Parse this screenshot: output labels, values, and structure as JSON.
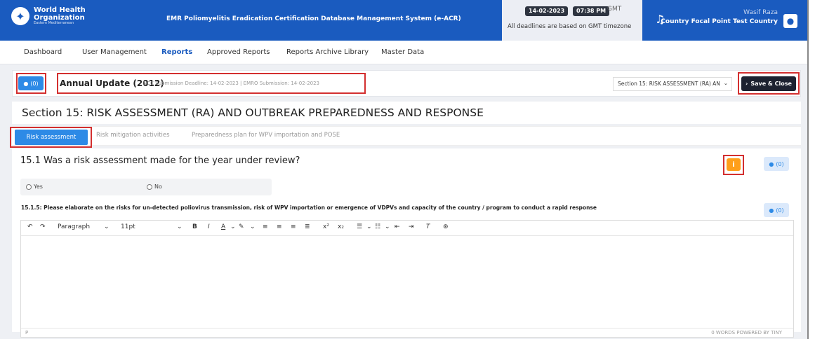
{
  "header": {
    "logo_line1": "World Health",
    "logo_line2": "Organization",
    "logo_line3": "Eastern Mediterranean",
    "app_title": "EMR Poliomyelitis Eradication Certification Database Management System (e-ACR)",
    "date": "14-02-2023",
    "time": "07:38 PM",
    "timezone": "GMT",
    "deadline_note": "All deadlines are based on GMT timezone",
    "user_name": "Wasif Raza",
    "user_role": "Country Focal Point Test Country"
  },
  "nav": {
    "items": [
      {
        "label": "Dashboard"
      },
      {
        "label": "User Management"
      },
      {
        "label": "Reports"
      },
      {
        "label": "Approved Reports"
      },
      {
        "label": "Reports Archive Library"
      },
      {
        "label": "Master Data"
      }
    ]
  },
  "report": {
    "comments_count": "(0)",
    "title": "Annual Update (2012)",
    "deadlines": "NCC Submission Deadline: 14-02-2023 | EMRO Submission: 14-02-2023",
    "section_select": "Section 15: RISK ASSESSMENT (RA) AN",
    "save_label": "Save & Close"
  },
  "section": {
    "title": "Section 15: RISK ASSESSMENT (RA) AND OUTBREAK PREPAREDNESS AND RESPONSE",
    "tabs": [
      {
        "label": "Risk assessment"
      },
      {
        "label": "Risk mitigation activities"
      },
      {
        "label": "Preparedness plan for WPV importation and POSE"
      }
    ]
  },
  "question": {
    "title": "15.1 Was a risk assessment made for the year under review?",
    "info_icon": "i",
    "comments_count": "(0)",
    "options": [
      {
        "label": "Yes"
      },
      {
        "label": "No"
      }
    ],
    "sub_question": "15.1.5: Please elaborate on the risks for un-detected poliovirus transmission, risk of WPV importation or emergence of VDPVs and capacity of the country / program to conduct a rapid response",
    "sub_comments_count": "(0)"
  },
  "editor": {
    "block_format": "Paragraph",
    "font_size": "11pt",
    "status_path": "P",
    "status_words": "0 WORDS  POWERED BY TINY"
  },
  "colors": {
    "brand": "#1a5bbf",
    "accent": "#2d8ae6",
    "highlight": "#d32f2f",
    "warning": "#ff9f1a"
  }
}
